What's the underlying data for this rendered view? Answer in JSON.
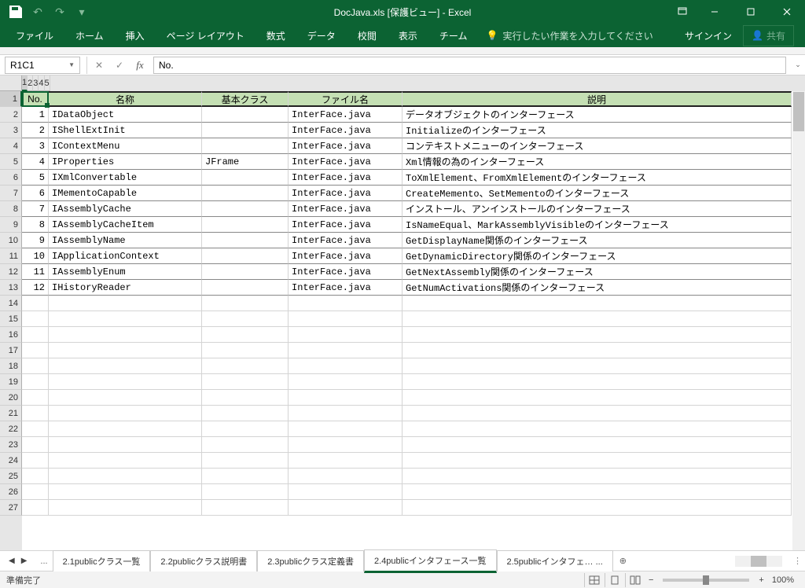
{
  "title": "DocJava.xls  [保護ビュー] - Excel",
  "qat": {
    "undo": "↶",
    "redo": "↷",
    "dd": "▾"
  },
  "win": {
    "ribopt": "▢",
    "min": "—",
    "max": "☐",
    "close": "✕"
  },
  "ribbon": {
    "file": "ファイル",
    "home": "ホーム",
    "insert": "挿入",
    "layout": "ページ レイアウト",
    "formulas": "数式",
    "data": "データ",
    "review": "校閲",
    "view": "表示",
    "team": "チーム",
    "tellme": "実行したい作業を入力してください",
    "signin": "サインイン",
    "share": "共有"
  },
  "namebox": "R1C1",
  "formula": "No.",
  "cols": [
    "1",
    "2",
    "3",
    "4",
    "5"
  ],
  "headers": {
    "c1": "No.",
    "c2": "名称",
    "c3": "基本クラス",
    "c4": "ファイル名",
    "c5": "説明"
  },
  "rows": [
    {
      "no": "1",
      "name": "IDataObject",
      "base": "",
      "file": "InterFace.java",
      "desc": "データオブジェクトのインターフェース"
    },
    {
      "no": "2",
      "name": "IShellExtInit",
      "base": "",
      "file": "InterFace.java",
      "desc": "Initializeのインターフェース"
    },
    {
      "no": "3",
      "name": "IContextMenu",
      "base": "",
      "file": "InterFace.java",
      "desc": "コンテキストメニューのインターフェース"
    },
    {
      "no": "4",
      "name": "IProperties",
      "base": "JFrame",
      "file": "InterFace.java",
      "desc": "Xml情報の為のインターフェース"
    },
    {
      "no": "5",
      "name": "IXmlConvertable",
      "base": "",
      "file": "InterFace.java",
      "desc": "ToXmlElement、FromXmlElementのインターフェース"
    },
    {
      "no": "6",
      "name": "IMementoCapable",
      "base": "",
      "file": "InterFace.java",
      "desc": "CreateMemento、SetMementoのインターフェース"
    },
    {
      "no": "7",
      "name": "IAssemblyCache",
      "base": "",
      "file": "InterFace.java",
      "desc": "インストール、アンインストールのインターフェース"
    },
    {
      "no": "8",
      "name": "IAssemblyCacheItem",
      "base": "",
      "file": "InterFace.java",
      "desc": "IsNameEqual、MarkAssemblyVisibleのインターフェース"
    },
    {
      "no": "9",
      "name": "IAssemblyName",
      "base": "",
      "file": "InterFace.java",
      "desc": "GetDisplayName関係のインターフェース"
    },
    {
      "no": "10",
      "name": "IApplicationContext",
      "base": "",
      "file": "InterFace.java",
      "desc": "GetDynamicDirectory関係のインターフェース"
    },
    {
      "no": "11",
      "name": "IAssemblyEnum",
      "base": "",
      "file": "InterFace.java",
      "desc": "GetNextAssembly関係のインターフェース"
    },
    {
      "no": "12",
      "name": "IHistoryReader",
      "base": "",
      "file": "InterFace.java",
      "desc": "GetNumActivations関係のインターフェース"
    }
  ],
  "emptyRows": 14,
  "tabs": {
    "ell": "...",
    "t1": "2.1publicクラス一覧",
    "t2": "2.2publicクラス説明書",
    "t3": "2.3publicクラス定義書",
    "t4": "2.4publicインタフェース一覧",
    "t5": "2.5publicインタフェ… ...",
    "add": "⊕"
  },
  "status": {
    "ready": "準備完了",
    "zoom": "100%"
  }
}
